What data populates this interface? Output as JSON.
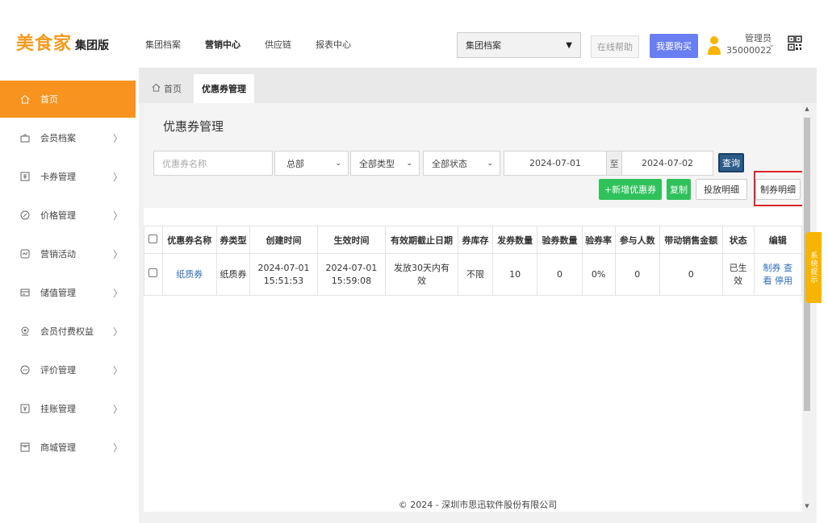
{
  "header": {
    "brand": "美食家",
    "edition": "集团版",
    "nav": [
      {
        "label": "集团档案",
        "active": false
      },
      {
        "label": "营销中心",
        "active": true
      },
      {
        "label": "供应链",
        "active": false
      },
      {
        "label": "报表中心",
        "active": false
      }
    ],
    "group_select": "集团档案",
    "help": "在线帮助",
    "buy": "我要购买",
    "user_role": "管理员",
    "user_id": "35000022"
  },
  "sidebar": {
    "items": [
      {
        "label": "首页",
        "icon": "home-icon",
        "active": true
      },
      {
        "label": "会员档案",
        "icon": "member-icon",
        "active": false
      },
      {
        "label": "卡券管理",
        "icon": "card-icon",
        "active": false
      },
      {
        "label": "价格管理",
        "icon": "price-icon",
        "active": false
      },
      {
        "label": "营销活动",
        "icon": "marketing-icon",
        "active": false
      },
      {
        "label": "储值管理",
        "icon": "stored-value-icon",
        "active": false
      },
      {
        "label": "会员付费权益",
        "icon": "paid-benefit-icon",
        "active": false
      },
      {
        "label": "评价管理",
        "icon": "review-icon",
        "active": false
      },
      {
        "label": "挂账管理",
        "icon": "credit-icon",
        "active": false
      },
      {
        "label": "商城管理",
        "icon": "mall-icon",
        "active": false
      }
    ]
  },
  "tabs": [
    {
      "label": "首页",
      "active": false
    },
    {
      "label": "优惠券管理",
      "active": true
    }
  ],
  "page": {
    "title": "优惠券管理",
    "filters": {
      "name_placeholder": "优惠券名称",
      "store": "总部",
      "type": "全部类型",
      "status": "全部状态",
      "date_from": "2024-07-01",
      "to_label": "至",
      "date_to": "2024-07-02",
      "query": "查询"
    },
    "actions": {
      "add": "+新增优惠券",
      "copy": "复制",
      "issue_detail": "投放明细",
      "make_detail": "制券明细"
    }
  },
  "table": {
    "columns": [
      "优惠券名称",
      "券类型",
      "创建时间",
      "生效时间",
      "有效期截止日期",
      "券库存",
      "发券数量",
      "验券数量",
      "验券率",
      "参与人数",
      "带动销售金额",
      "状态",
      "编辑"
    ],
    "rows": [
      {
        "name": "纸质券",
        "type": "纸质券",
        "created_date": "2024-07-01",
        "created_time": "15:51:53",
        "effective_date": "2024-07-01",
        "effective_time": "15:59:08",
        "expiry_line1": "发放30天内有",
        "expiry_line2": "效",
        "stock": "不限",
        "issued": "10",
        "verified": "0",
        "verify_rate": "0%",
        "participants": "0",
        "sales": "0",
        "status_line1": "已生",
        "status_line2": "效",
        "edit_make": "制券",
        "edit_view": "查",
        "edit_view2": "看",
        "edit_disable": "停用"
      }
    ]
  },
  "footer": "© 2024 - 深圳市思迅软件股份有限公司",
  "system_tip": "系统提示",
  "colors": {
    "brand": "#f39a1e",
    "sidebar_active": "#f7931e",
    "green": "#2fc25b",
    "query": "#2b5d8a",
    "buy": "#6a7ef3",
    "highlight": "#e0242b",
    "tip": "#f7b500"
  }
}
